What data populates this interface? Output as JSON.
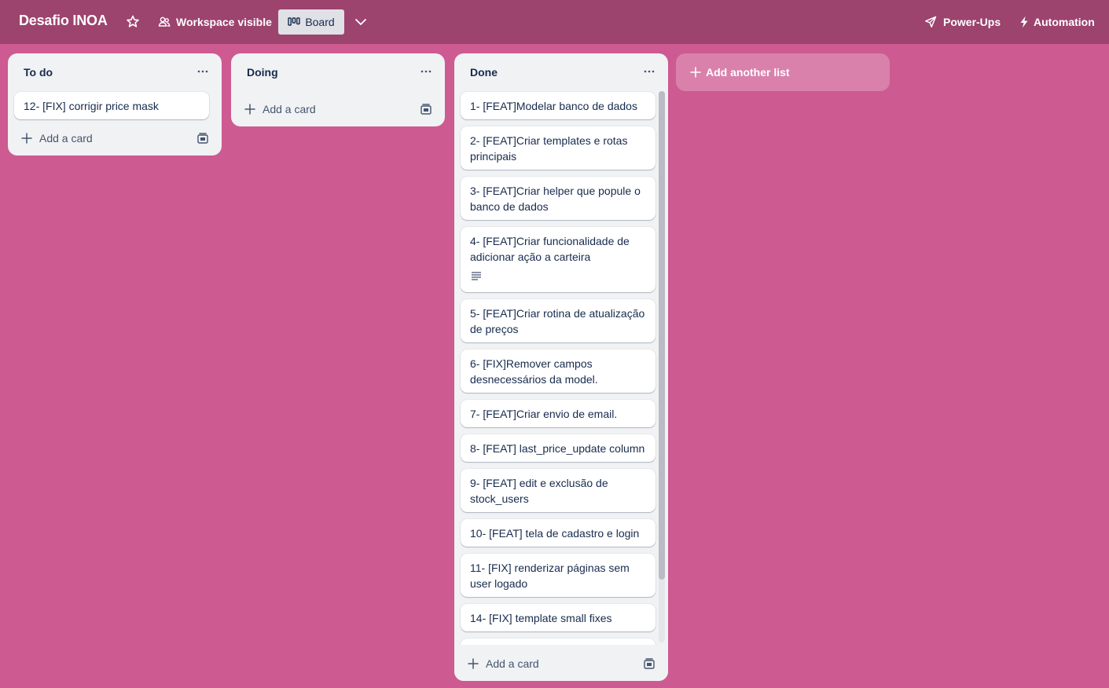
{
  "header": {
    "board_title": "Desafio INOA",
    "workspace_label": "Workspace visible",
    "board_view_label": "Board",
    "powerups_label": "Power-Ups",
    "automation_label": "Automation",
    "background_color": "#9c436e"
  },
  "board": {
    "background_color": "#cd5a91",
    "lists": [
      {
        "title": "To do",
        "cards": [
          {
            "text": "12- [FIX] corrigir price mask"
          }
        ],
        "add_card_label": "Add a card"
      },
      {
        "title": "Doing",
        "cards": [],
        "add_card_label": "Add a card"
      },
      {
        "title": "Done",
        "cards": [
          {
            "text": "1- [FEAT]Modelar banco de dados"
          },
          {
            "text": "2- [FEAT]Criar templates e rotas principais"
          },
          {
            "text": "3- [FEAT]Criar helper que popule o banco de dados"
          },
          {
            "text": "4- [FEAT]Criar funcionalidade de adicionar ação a carteira",
            "badge": "description-icon"
          },
          {
            "text": "5- [FEAT]Criar rotina de atualização de preços"
          },
          {
            "text": "6- [FIX]Remover campos desnecessários da model."
          },
          {
            "text": "7- [FEAT]Criar envio de email."
          },
          {
            "text": "8- [FEAT] last_price_update column"
          },
          {
            "text": "9- [FEAT] edit e exclusão de stock_users"
          },
          {
            "text": "10- [FEAT] tela de cadastro e login"
          },
          {
            "text": "11- [FIX] renderizar páginas sem user logado"
          },
          {
            "text": "14- [FIX] template small fixes"
          }
        ],
        "add_card_label": "Add a card"
      }
    ],
    "add_list_label": "Add another list"
  }
}
